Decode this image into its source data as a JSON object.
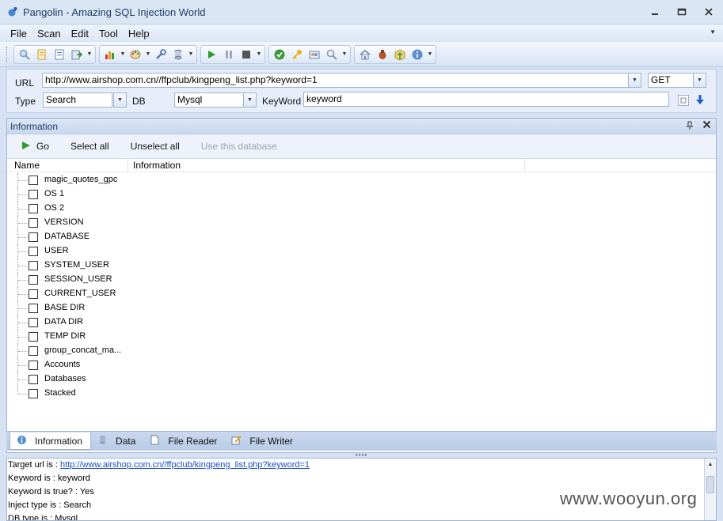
{
  "window": {
    "title": "Pangolin - Amazing SQL Injection World",
    "minimize": "▭",
    "restore": "▣",
    "close": "✕"
  },
  "menu": [
    "File",
    "Scan",
    "Edit",
    "Tool",
    "Help"
  ],
  "form": {
    "url_label": "URL",
    "url_value": "http://www.airshop.com.cn//ffpclub/kingpeng_list.php?keyword=1",
    "method_value": "GET",
    "type_label": "Type",
    "type_value": "Search",
    "db_label": "DB",
    "db_value": "Mysql",
    "keyword_label": "KeyWord",
    "keyword_value": "keyword"
  },
  "panel": {
    "title": "Information",
    "actions": {
      "go": "Go",
      "select_all": "Select all",
      "unselect_all": "Unselect all",
      "use_db": "Use this database"
    },
    "columns": {
      "name": "Name",
      "info": "Information"
    },
    "items": [
      "magic_quotes_gpc",
      "OS 1",
      "OS 2",
      "VERSION",
      "DATABASE",
      "USER",
      "SYSTEM_USER",
      "SESSION_USER",
      "CURRENT_USER",
      "BASE DIR",
      "DATA DIR",
      "TEMP DIR",
      "group_concat_ma...",
      "Accounts",
      "Databases",
      "Stacked"
    ]
  },
  "tabs": [
    "Information",
    "Data",
    "File Reader",
    "File Writer"
  ],
  "log": {
    "target_label": "Target url is : ",
    "target_url": "http://www.airshop.com.cn//ffpclub/kingpeng_list.php?keyword=1",
    "lines": [
      "Keyword is : keyword",
      "Keyword is true? : Yes",
      "Inject type is : Search",
      "DB type is : Mysql"
    ]
  },
  "watermark": "www.wooyun.org"
}
